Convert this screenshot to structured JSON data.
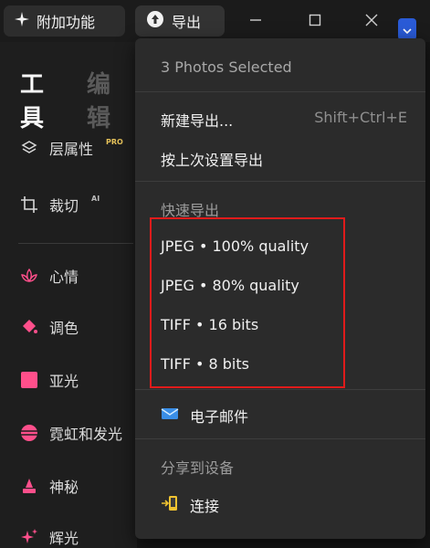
{
  "topbar": {
    "addons_label": "附加功能",
    "export_label": "导出"
  },
  "panel": {
    "tab_tools": "工具",
    "tab_edit": "编辑",
    "items": [
      {
        "label": "层属性",
        "badge": "PRO"
      },
      {
        "label": "裁切",
        "badge": "AI"
      },
      {
        "label": "心情"
      },
      {
        "label": "调色"
      },
      {
        "label": "亚光"
      },
      {
        "label": "霓虹和发光"
      },
      {
        "label": "神秘"
      },
      {
        "label": "辉光"
      }
    ]
  },
  "menu": {
    "selection_text": "3 Photos Selected",
    "new_export": "新建导出...",
    "new_export_shortcut": "Shift+Ctrl+E",
    "export_last": "按上次设置导出",
    "quick_header": "快速导出",
    "quick_items": [
      "JPEG • 100% quality",
      "JPEG • 80% quality",
      "TIFF • 16 bits",
      "TIFF • 8 bits"
    ],
    "email": "电子邮件",
    "share_header": "分享到设备",
    "connect": "连接"
  },
  "colors": {
    "accent_blue": "#2a5bd7",
    "highlight_red": "#e01b1b",
    "pro_badge": "#e7c35a",
    "icon_pink": "#ff4f8b"
  }
}
